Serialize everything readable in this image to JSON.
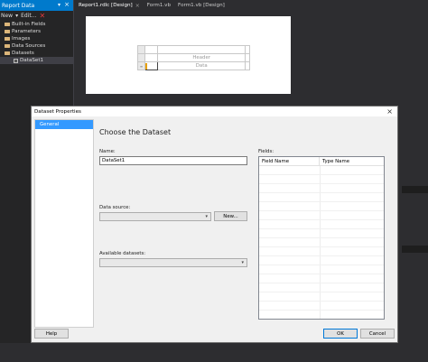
{
  "left_panel": {
    "title": "Report Data",
    "toolbar": {
      "new_label": "New",
      "edit_label": "Edit..."
    },
    "tree": [
      {
        "label": "Built-in Fields",
        "icon": "folder-icon"
      },
      {
        "label": "Parameters",
        "icon": "folder-icon"
      },
      {
        "label": "Images",
        "icon": "folder-icon"
      },
      {
        "label": "Data Sources",
        "icon": "folder-icon"
      },
      {
        "label": "Datasets",
        "icon": "folder-icon"
      },
      {
        "label": "DataSet1",
        "icon": "dataset-icon"
      }
    ]
  },
  "tabs": [
    {
      "label": "Report1.rdlc [Design]"
    },
    {
      "label": "Form1.vb"
    },
    {
      "label": "Form1.vb [Design]"
    }
  ],
  "design": {
    "header_cell": "Header",
    "data_cell": "Data"
  },
  "dialog": {
    "title": "Dataset Properties",
    "sidebar": [
      {
        "label": "General"
      }
    ],
    "heading": "Choose the Dataset",
    "name_label": "Name:",
    "name_value": "DataSet1",
    "datasource_label": "Data source:",
    "datasource_value": "",
    "new_button": "New...",
    "available_label": "Available datasets:",
    "available_value": "",
    "fields_label": "Fields:",
    "fields_columns": [
      "Field Name",
      "Type Name"
    ],
    "help_button": "Help",
    "ok_button": "OK",
    "cancel_button": "Cancel"
  },
  "colors": {
    "accent": "#007acc",
    "selection": "#3399ff",
    "ide_background": "#2d2d30"
  }
}
